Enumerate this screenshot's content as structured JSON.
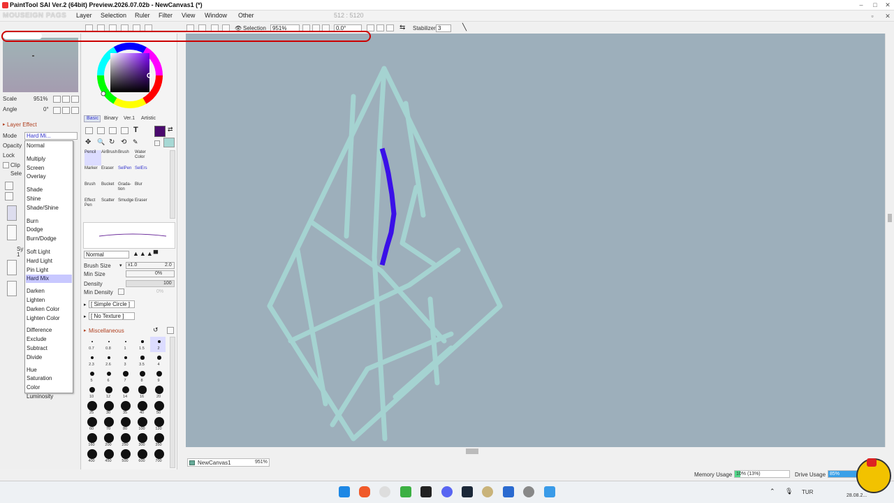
{
  "window": {
    "title": "PaintTool SAI Ver.2 (64bit) Preview.2026.07.02b - NewCanvas1 (*)"
  },
  "overlay_logo": "MOUSEIGN PAGS",
  "menu": [
    "Layer",
    "Selection",
    "Ruler",
    "Filter",
    "View",
    "Window",
    "Other"
  ],
  "menu_coords": "512 : 5120",
  "toolbar": {
    "selection_label": "Selection",
    "zoom": "951%",
    "angle": "0.0°",
    "stabilizer_label": "Stabilizer",
    "stabilizer_value": "3"
  },
  "navigator": {
    "scale_label": "Scale",
    "scale_value": "951%",
    "angle_label": "Angle",
    "angle_value": "0°"
  },
  "layer": {
    "effect_label": "Layer Effect",
    "mode_label": "Mode",
    "mode_value": "Hard Mi...",
    "opacity_label": "Opacity",
    "lock_label": "Lock",
    "clip_label": "Clip",
    "sel_label": "Sele",
    "sy_label": "Sy",
    "one_label": "1"
  },
  "blend_modes": [
    "Normal",
    "Multiply",
    "Screen",
    "Overlay",
    "Shade",
    "Shine",
    "Shade/Shine",
    "Burn",
    "Dodge",
    "Burn/Dodge",
    "Soft Light",
    "Hard Light",
    "Pin Light",
    "Hard Mix",
    "Darken",
    "Lighten",
    "Darken Color",
    "Lighten Color",
    "Difference",
    "Exclude",
    "Subtract",
    "Divide",
    "Hue",
    "Saturation",
    "Color",
    "Luminosity"
  ],
  "blend_selected": "Hard Mix",
  "color_tabs": [
    "Basic",
    "Binary",
    "Ver.1",
    "Artistic"
  ],
  "colors": {
    "primary": "#4a0a6e",
    "secondary": "#a6d8d4",
    "canvas_bg": "#9dafbb",
    "stroke_teal": "#a6d8d4",
    "stroke_blue": "#3a10e8"
  },
  "tools": [
    {
      "l1": "Pencil",
      "l2": "",
      "hl": true,
      "blue": false
    },
    {
      "l1": "AirBrush",
      "l2": "",
      "hl": false,
      "blue": false
    },
    {
      "l1": "Brush",
      "l2": "",
      "hl": false,
      "blue": false
    },
    {
      "l1": "Water",
      "l2": "Color",
      "hl": false,
      "blue": false
    },
    {
      "l1": "Marker",
      "l2": "",
      "hl": false,
      "blue": false
    },
    {
      "l1": "Eraser",
      "l2": "",
      "hl": false,
      "blue": false
    },
    {
      "l1": "SelPen",
      "l2": "",
      "hl": false,
      "blue": true
    },
    {
      "l1": "SelErs",
      "l2": "",
      "hl": false,
      "blue": true
    },
    {
      "l1": "Brush",
      "l2": "",
      "hl": false,
      "blue": false
    },
    {
      "l1": "Bucket",
      "l2": "",
      "hl": false,
      "blue": false
    },
    {
      "l1": "Grada-",
      "l2": "tion",
      "hl": false,
      "blue": false
    },
    {
      "l1": "Blur",
      "l2": "",
      "hl": false,
      "blue": false
    },
    {
      "l1": "Effect",
      "l2": "Pen",
      "hl": false,
      "blue": false
    },
    {
      "l1": "Scatter",
      "l2": "",
      "hl": false,
      "blue": false
    },
    {
      "l1": "Smudge",
      "l2": "",
      "hl": false,
      "blue": false
    },
    {
      "l1": "Eraser",
      "l2": "",
      "hl": false,
      "blue": false
    }
  ],
  "brush": {
    "blend": "Normal",
    "size_label": "Brush Size",
    "size_mult": "x1.0",
    "size_value": "2.0",
    "min_size_label": "Min Size",
    "min_size_value": "0%",
    "density_label": "Density",
    "density_value": "100",
    "min_density_label": "Min Density",
    "min_density_value": "0%",
    "shape": "[ Simple Circle ]",
    "texture": "[ No Texture ]",
    "misc_label": "Miscellaneous"
  },
  "brush_sizes": [
    "0.7",
    "0.8",
    "1",
    "1.5",
    "2",
    "2.3",
    "2.6",
    "3",
    "3.5",
    "4",
    "5",
    "6",
    "7",
    "8",
    "9",
    "10",
    "12",
    "14",
    "16",
    "20",
    "25",
    "30",
    "35",
    "40",
    "50",
    "60",
    "70",
    "80",
    "100",
    "120",
    "160",
    "200",
    "250",
    "300",
    "350",
    "400",
    "450",
    "500",
    "600",
    "700"
  ],
  "canvas_tab": {
    "name": "NewCanvas1",
    "zoom": "951%"
  },
  "status": {
    "memory_label": "Memory Usage",
    "memory_value": "10% (13%)",
    "memory_fraction": 0.1,
    "drive_label": "Drive Usage",
    "drive_value": "85%",
    "drive_fraction": 0.85
  },
  "tray": {
    "lang": "TUR",
    "date": "28.08.2..."
  }
}
